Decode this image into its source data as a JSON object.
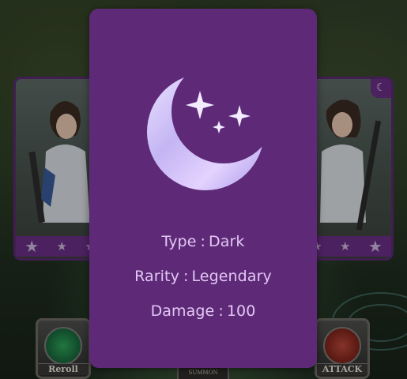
{
  "modal": {
    "icon": "crescent-moon-with-sparkles-icon",
    "stats": [
      {
        "label": "Type",
        "separator": ":",
        "value": "Dark"
      },
      {
        "label": "Rarity",
        "separator": ":",
        "value": "Legendary"
      },
      {
        "label": "Damage",
        "separator": ":",
        "value": "100"
      }
    ],
    "colors": {
      "card_background": "#5e2a78",
      "text": "#e2c7f3",
      "moon_light": "#e7dbff",
      "moon_mid": "#b9a9f0"
    }
  },
  "side_cards": [
    {
      "position": "left",
      "stars_shown": 3,
      "frame_color": "#5a2a72"
    },
    {
      "position": "right",
      "stars_shown": 3,
      "frame_color": "#5a2a72",
      "corner_icon": "crescent-moon-icon"
    }
  ],
  "buttons": {
    "reroll": "Reroll",
    "summon": "SUMMON",
    "attack": "ATTACK"
  }
}
